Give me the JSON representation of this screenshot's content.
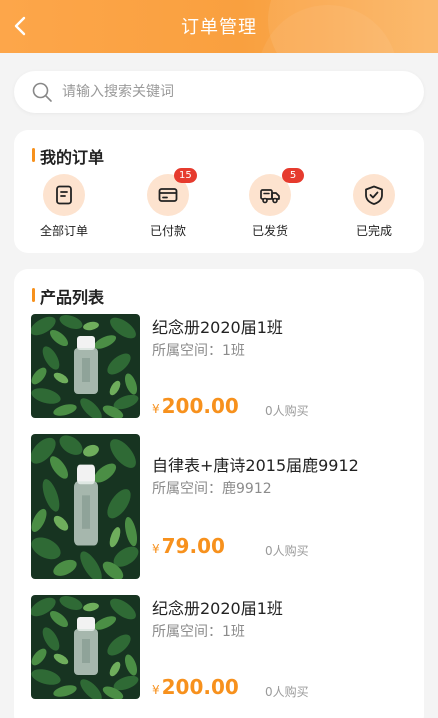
{
  "header": {
    "title": "订单管理",
    "colors": {
      "accent": "#f9a03f"
    }
  },
  "search": {
    "placeholder": "请输入搜索关键词"
  },
  "orders": {
    "title": "我的订单",
    "items": [
      {
        "label": "全部订单",
        "icon": "receipt-icon"
      },
      {
        "label": "已付款",
        "icon": "wallet-icon",
        "badge": "15"
      },
      {
        "label": "已发货",
        "icon": "truck-icon",
        "badge": "5"
      },
      {
        "label": "已完成",
        "icon": "shield-check-icon"
      }
    ]
  },
  "products": {
    "title": "产品列表",
    "items": [
      {
        "name": "纪念册2020届1班",
        "space": "所属空间：1班",
        "currency": "¥",
        "price": "200.00",
        "sales": "0人购买"
      },
      {
        "name": "自律表+唐诗2015届鹿9912",
        "space": "所属空间：鹿9912",
        "currency": "¥",
        "price": "79.00",
        "sales": "0人购买"
      },
      {
        "name": "纪念册2020届1班",
        "space": "所属空间：1班",
        "currency": "¥",
        "price": "200.00",
        "sales": "0人购买"
      }
    ]
  }
}
